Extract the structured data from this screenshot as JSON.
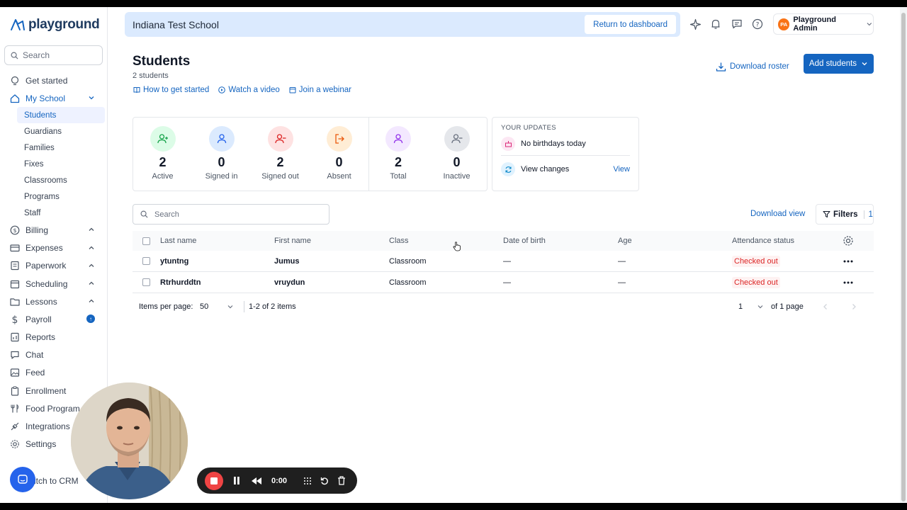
{
  "app": {
    "logo_text": "playground"
  },
  "sidebar": {
    "search_placeholder": "Search",
    "items": [
      {
        "label": "Get started",
        "icon": "bulb-icon"
      },
      {
        "label": "My School",
        "icon": "home-icon"
      },
      {
        "label": "Billing",
        "icon": "dollar-circle-icon"
      },
      {
        "label": "Expenses",
        "icon": "card-icon"
      },
      {
        "label": "Paperwork",
        "icon": "paperwork-icon"
      },
      {
        "label": "Scheduling",
        "icon": "calendar-icon"
      },
      {
        "label": "Lessons",
        "icon": "folder-icon"
      },
      {
        "label": "Payroll",
        "icon": "dollar-icon",
        "badge": "↑"
      },
      {
        "label": "Reports",
        "icon": "chart-icon"
      },
      {
        "label": "Chat",
        "icon": "chat-icon"
      },
      {
        "label": "Feed",
        "icon": "image-icon"
      },
      {
        "label": "Enrollment",
        "icon": "clipboard-icon"
      },
      {
        "label": "Food Program",
        "icon": "utensils-icon"
      },
      {
        "label": "Integrations",
        "icon": "plug-icon"
      },
      {
        "label": "Settings",
        "icon": "gear-icon"
      }
    ],
    "school_sub": [
      "Students",
      "Guardians",
      "Families",
      "Fixes",
      "Classrooms",
      "Programs",
      "Staff"
    ],
    "switch_label": "itch to CRM"
  },
  "header": {
    "school_name": "Indiana Test School",
    "return_label": "Return to dashboard",
    "user_initials": "PA",
    "user_name": "Playground Admin"
  },
  "page": {
    "title": "Students",
    "subtitle": "2 students",
    "links": [
      "How to get started",
      "Watch a video",
      "Join a webinar"
    ],
    "download_roster": "Download roster",
    "add_students": "Add students"
  },
  "stats": [
    {
      "value": "2",
      "label": "Active",
      "color": "#16a34a",
      "bg": "#dcfce7"
    },
    {
      "value": "0",
      "label": "Signed in",
      "color": "#2563eb",
      "bg": "#dbeafe"
    },
    {
      "value": "2",
      "label": "Signed out",
      "color": "#dc2626",
      "bg": "#fee2e2"
    },
    {
      "value": "0",
      "label": "Absent",
      "color": "#ea580c",
      "bg": "#ffedd5"
    },
    {
      "value": "2",
      "label": "Total",
      "color": "#9333ea",
      "bg": "#f3e8ff"
    },
    {
      "value": "0",
      "label": "Inactive",
      "color": "#6b7280",
      "bg": "#e5e7eb"
    }
  ],
  "updates": {
    "title": "YOUR UPDATES",
    "birthdays": "No birthdays today",
    "changes": "View changes",
    "view": "View"
  },
  "table": {
    "search_placeholder": "Search",
    "download_view": "Download view",
    "filters_label": "Filters",
    "filters_count": "1",
    "columns": [
      "Last name",
      "First name",
      "Class",
      "Date of birth",
      "Age",
      "Attendance status"
    ],
    "rows": [
      {
        "last": "ytuntng",
        "first": "Jumus",
        "class": "Classroom",
        "dob": "—",
        "age": "—",
        "status": "Checked out"
      },
      {
        "last": "Rtrhurddtn",
        "first": "vruydun",
        "class": "Classroom",
        "dob": "—",
        "age": "—",
        "status": "Checked out"
      }
    ],
    "items_per_page_label": "Items per page:",
    "items_per_page": "50",
    "range": "1-2 of 2 items",
    "page": "1",
    "of_pages": "of 1 page"
  },
  "recorder": {
    "time": "0:00"
  }
}
